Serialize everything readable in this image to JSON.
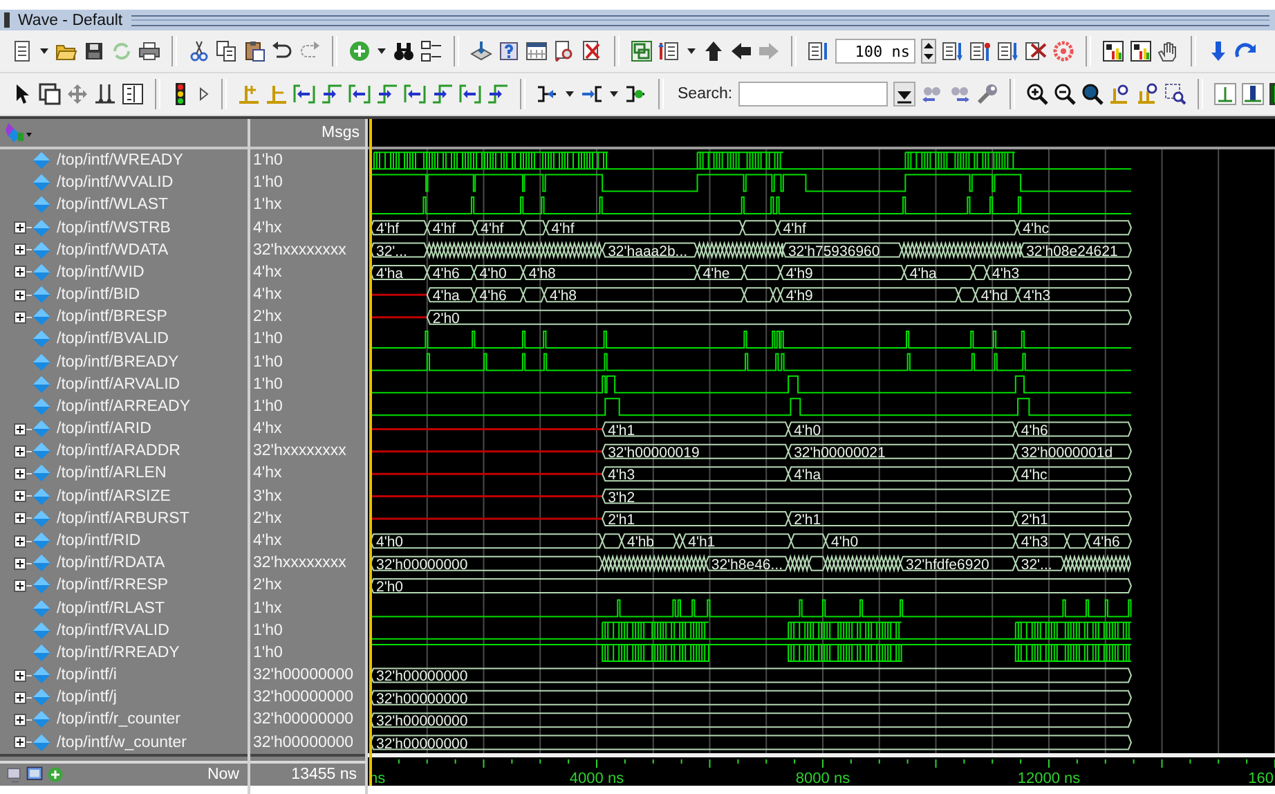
{
  "window": {
    "title": "Wave - Default"
  },
  "toolbar": {
    "time_step": "100 ns",
    "search_label": "Search:"
  },
  "header": {
    "msgs_label": "Msgs"
  },
  "signals": [
    {
      "name": "/top/intf/WREADY",
      "value": "1'h0",
      "expandable": false,
      "kind": "bit"
    },
    {
      "name": "/top/intf/WVALID",
      "value": "1'h0",
      "expandable": false,
      "kind": "bit"
    },
    {
      "name": "/top/intf/WLAST",
      "value": "1'hx",
      "expandable": false,
      "kind": "bit"
    },
    {
      "name": "/top/intf/WSTRB",
      "value": "4'hx",
      "expandable": true,
      "kind": "bus",
      "labels": [
        "4'hf",
        "4'hf",
        "4'hf",
        "4'hf",
        "4'hf",
        "4'hc"
      ]
    },
    {
      "name": "/top/intf/WDATA",
      "value": "32'hxxxxxxxx",
      "expandable": true,
      "kind": "bus",
      "labels": [
        "32'...",
        "32'haaa2b...",
        "32'h75936960",
        "32'h08e24621"
      ]
    },
    {
      "name": "/top/intf/WID",
      "value": "4'hx",
      "expandable": true,
      "kind": "bus",
      "labels": [
        "4'ha",
        "4'h6",
        "4'h0",
        "4'h8",
        "4'he",
        "4'h9",
        "4'ha",
        "4'h3"
      ]
    },
    {
      "name": "/top/intf/BID",
      "value": "4'hx",
      "expandable": true,
      "kind": "bus",
      "labels": [
        "4'ha",
        "4'h6",
        "4'h8",
        "4'h9",
        "4'hd",
        "4'h3"
      ]
    },
    {
      "name": "/top/intf/BRESP",
      "value": "2'hx",
      "expandable": true,
      "kind": "bus",
      "labels": [
        "2'h0"
      ]
    },
    {
      "name": "/top/intf/BVALID",
      "value": "1'h0",
      "expandable": false,
      "kind": "bit"
    },
    {
      "name": "/top/intf/BREADY",
      "value": "1'h0",
      "expandable": false,
      "kind": "bit"
    },
    {
      "name": "/top/intf/ARVALID",
      "value": "1'h0",
      "expandable": false,
      "kind": "bit"
    },
    {
      "name": "/top/intf/ARREADY",
      "value": "1'h0",
      "expandable": false,
      "kind": "bit"
    },
    {
      "name": "/top/intf/ARID",
      "value": "4'hx",
      "expandable": true,
      "kind": "bus",
      "labels": [
        "4'h1",
        "4'h0",
        "4'h6"
      ]
    },
    {
      "name": "/top/intf/ARADDR",
      "value": "32'hxxxxxxxx",
      "expandable": true,
      "kind": "bus",
      "labels": [
        "32'h00000019",
        "32'h00000021",
        "32'h0000001d"
      ]
    },
    {
      "name": "/top/intf/ARLEN",
      "value": "4'hx",
      "expandable": true,
      "kind": "bus",
      "labels": [
        "4'h3",
        "4'ha",
        "4'hc"
      ]
    },
    {
      "name": "/top/intf/ARSIZE",
      "value": "3'hx",
      "expandable": true,
      "kind": "bus",
      "labels": [
        "3'h2"
      ]
    },
    {
      "name": "/top/intf/ARBURST",
      "value": "2'hx",
      "expandable": true,
      "kind": "bus",
      "labels": [
        "2'h1",
        "2'h1",
        "2'h1"
      ]
    },
    {
      "name": "/top/intf/RID",
      "value": "4'hx",
      "expandable": true,
      "kind": "bus",
      "labels": [
        "4'h0",
        "4'hb",
        "4'h1",
        "4'h0",
        "4'h3",
        "4'h6"
      ]
    },
    {
      "name": "/top/intf/RDATA",
      "value": "32'hxxxxxxxx",
      "expandable": true,
      "kind": "bus",
      "labels": [
        "32'h00000000",
        "32'h8e46...",
        "32'hfdfe6920",
        "32'..."
      ]
    },
    {
      "name": "/top/intf/RRESP",
      "value": "2'hx",
      "expandable": true,
      "kind": "bus",
      "labels": [
        "2'h0"
      ]
    },
    {
      "name": "/top/intf/RLAST",
      "value": "1'hx",
      "expandable": false,
      "kind": "bit"
    },
    {
      "name": "/top/intf/RVALID",
      "value": "1'h0",
      "expandable": false,
      "kind": "bit"
    },
    {
      "name": "/top/intf/RREADY",
      "value": "1'h0",
      "expandable": false,
      "kind": "bit"
    },
    {
      "name": "/top/intf/i",
      "value": "32'h00000000",
      "expandable": true,
      "kind": "bus",
      "labels": [
        "32'h00000000"
      ]
    },
    {
      "name": "/top/intf/j",
      "value": "32'h00000000",
      "expandable": true,
      "kind": "bus",
      "labels": [
        "32'h00000000"
      ]
    },
    {
      "name": "/top/intf/r_counter",
      "value": "32'h00000000",
      "expandable": true,
      "kind": "bus",
      "labels": [
        "32'h00000000"
      ]
    },
    {
      "name": "/top/intf/w_counter",
      "value": "32'h00000000",
      "expandable": true,
      "kind": "bus",
      "labels": [
        "32'h00000000"
      ]
    }
  ],
  "footer": {
    "now_label": "Now",
    "now_value": "13455 ns"
  },
  "time_axis": {
    "labels": [
      "ns",
      "4000 ns",
      "8000 ns",
      "12000 ns",
      "160"
    ]
  }
}
